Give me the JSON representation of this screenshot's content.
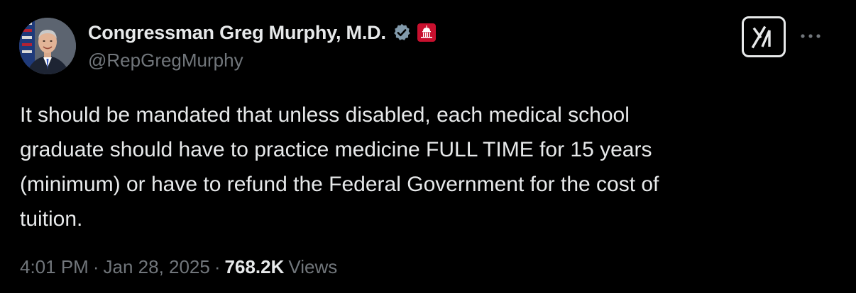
{
  "author": {
    "display_name": "Congressman Greg Murphy, M.D.",
    "handle": "@RepGregMurphy",
    "verified_badge_icon": "verified-badge-icon",
    "verified_badge_color": "#829aab",
    "affiliation_badge_icon": "capitol-building-icon",
    "affiliation_badge_color": "#c8102e"
  },
  "tweet": {
    "text": "It should be mandated that unless disabled, each medical school\ngraduate should have to practice medicine FULL TIME for 15 years\n(minimum) or have to refund the Federal Government for the cost of\ntuition."
  },
  "meta": {
    "time": "4:01 PM",
    "separator": "·",
    "date": "Jan 28, 2025",
    "views_count": "768.2K",
    "views_label": "Views"
  },
  "actions": {
    "grok_icon": "grok-icon",
    "more_icon": "more-horizontal-icon"
  },
  "colors": {
    "background": "#000000",
    "primary_text": "#e7e9ea",
    "secondary_text": "#71767b"
  }
}
